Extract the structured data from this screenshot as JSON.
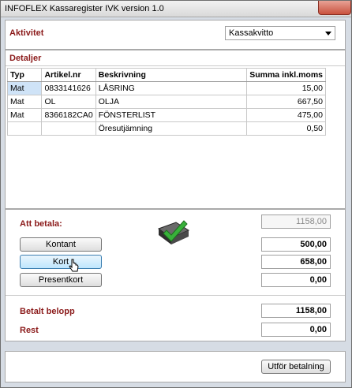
{
  "window": {
    "title": "INFOFLEX Kassaregister IVK version 1.0"
  },
  "aktivitet": {
    "label": "Aktivitet",
    "selected": "Kassakvitto"
  },
  "detaljer": {
    "label": "Detaljer",
    "columns": [
      "Typ",
      "Artikel.nr",
      "Beskrivning",
      "Summa inkl.moms"
    ],
    "rows": [
      {
        "typ": "Mat",
        "artikel": "0833141626",
        "beskrivning": "LÅSRING",
        "summa": "15,00"
      },
      {
        "typ": "Mat",
        "artikel": "OL",
        "beskrivning": "OLJA",
        "summa": "667,50"
      },
      {
        "typ": "Mat",
        "artikel": "8366182CA0",
        "beskrivning": "FÖNSTERLIST",
        "summa": "475,00"
      },
      {
        "typ": "",
        "artikel": "",
        "beskrivning": "Öresutjämning",
        "summa": "0,50"
      }
    ]
  },
  "payment": {
    "att_betala_label": "Att betala:",
    "att_betala_value": "1158,00",
    "kontant_label": "Kontant",
    "kontant_value": "500,00",
    "kort_label": "Kort",
    "kort_value": "658,00",
    "presentkort_label": "Presentkort",
    "presentkort_value": "0,00"
  },
  "totals": {
    "betalt_label": "Betalt belopp",
    "betalt_value": "1158,00",
    "rest_label": "Rest",
    "rest_value": "0,00"
  },
  "actions": {
    "utfor_label": "Utför betalning"
  },
  "icons": {
    "register": "checkmark-register-icon",
    "cursor": "mouse-pointer-icon"
  }
}
